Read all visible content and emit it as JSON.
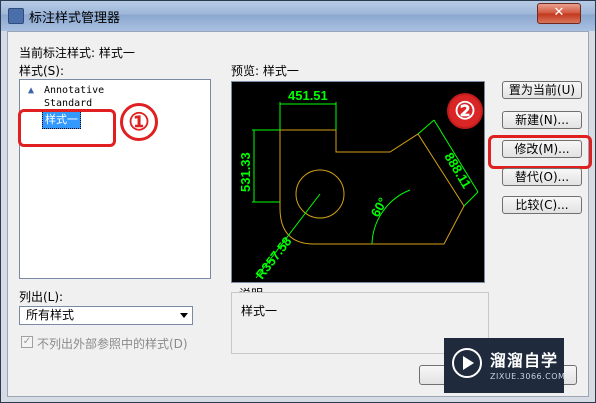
{
  "window": {
    "title": "标注样式管理器",
    "close_label": "✕"
  },
  "current_style": {
    "label": "当前标注样式: 样式一"
  },
  "styles": {
    "label": "样式(S):",
    "items": [
      "Annotative",
      "Standard",
      "样式一"
    ],
    "selected": "样式一"
  },
  "preview": {
    "label": "预览: 样式一",
    "dims": {
      "top": "451.51",
      "left": "531.33",
      "right": "888.11",
      "angle": "60°",
      "radius": "R357.58"
    },
    "colors": {
      "background": "#000000",
      "dimension": "#00ff00",
      "geometry": "#d4a017"
    }
  },
  "buttons": {
    "set_current": "置为当前(U)",
    "new": "新建(N)...",
    "modify": "修改(M)...",
    "override": "替代(O)...",
    "compare": "比较(C)..."
  },
  "list_filter": {
    "label": "列出(L):",
    "value": "所有样式"
  },
  "exclude_xref": {
    "label": "不列出外部参照中的样式(D)",
    "checked": true
  },
  "description": {
    "label": "说明",
    "text": "样式一"
  },
  "annotations": {
    "marker1": "①",
    "marker2": "②",
    "highlight_color": "#e02020"
  },
  "watermark": {
    "brand": "溜溜自学",
    "site": "ZIXUE.3066.COM"
  }
}
